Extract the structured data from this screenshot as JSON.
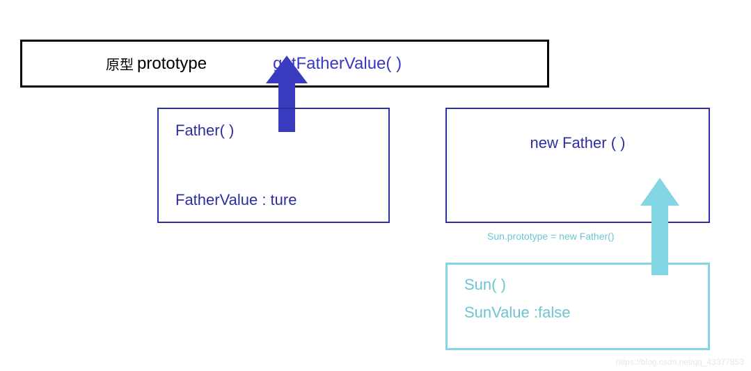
{
  "prototype": {
    "cn_label": "原型",
    "en_label": "prototype",
    "method": "getFatherValue( )"
  },
  "father": {
    "title": "Father(  )",
    "property": "FatherValue : ture"
  },
  "new_father": {
    "label": "new Father ( )"
  },
  "assignment": {
    "label": "Sun.prototype = new Father()"
  },
  "sun": {
    "title": "Sun( )",
    "property": "SunValue :false"
  },
  "watermark": "https://blog.csdn.net/qq_43377853",
  "colors": {
    "blue": "#2e2ea3",
    "arrow_blue": "#3b3bc0",
    "cyan": "#82d5e2"
  }
}
